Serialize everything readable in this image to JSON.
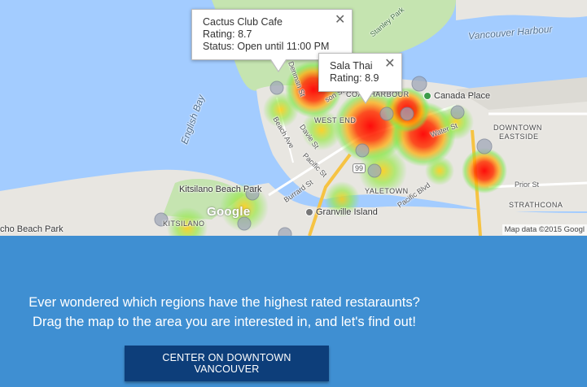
{
  "map": {
    "colors": {
      "water": "#a3ccff",
      "land": "#e8e6e1",
      "park": "#c5e4b0",
      "heat_hot": "#ff0000",
      "heat_warm": "#ffa500",
      "heat_cool": "#7ee84a",
      "pin": "#9aa3b5"
    },
    "labels": {
      "harbour": "Vancouver Harbour",
      "english_bay": "English Bay",
      "stanley_park": "Stanley Park",
      "canada_place": "Canada Place",
      "downtown_eastside_1": "DOWNTOWN",
      "downtown_eastside_2": "EASTSIDE",
      "west_end": "WEST END",
      "coal_harbour": "COAL HARBOUR",
      "yaletown": "YALETOWN",
      "kitsilano_beach_park": "Kitsilano Beach Park",
      "kitsilano": "KITSILANO",
      "granville_island": "Granville Island",
      "beach_park": "cho Beach Park",
      "strathcona": "STRATHCONA",
      "prior_st": "Prior St",
      "denman_st": "Denman St",
      "davie_st": "Davie St",
      "beach_ave": "Beach Ave",
      "pacific_st": "Pacific St",
      "burrard_st": "Burrard St",
      "pacific_blvd": "Pacific Blvd",
      "water_st": "Water St",
      "robson_st": "son St",
      "route_99": "99"
    },
    "google_logo": "Google",
    "attribution": "Map data ©2015 Googl"
  },
  "info_windows": [
    {
      "name": "Cactus Club Cafe",
      "rating": "Rating: 8.7",
      "status": "Status: Open until 11:00 PM",
      "close": "✕"
    },
    {
      "name": "Sala Thai",
      "rating": "Rating: 8.9",
      "close": "✕"
    }
  ],
  "panel": {
    "line1": "Ever wondered which regions have the highest rated restaraunts?",
    "line2": "Drag the map to the area you are interested in, and let's find out!",
    "button": "CENTER ON DOWNTOWN VANCOUVER"
  }
}
